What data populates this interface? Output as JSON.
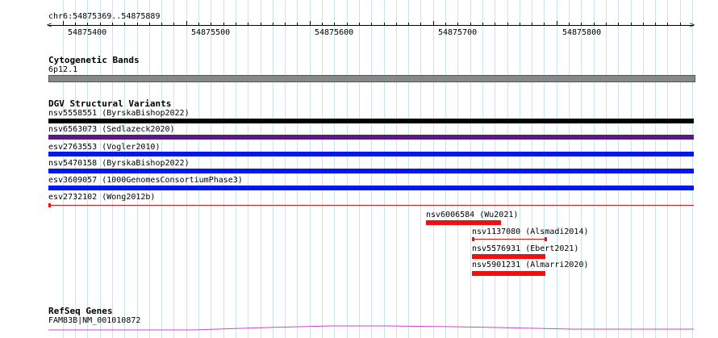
{
  "locus": "chr6:54875369..54875889",
  "ruler_ticks": [
    "54875400",
    "54875500",
    "54875600",
    "54875700",
    "54875800"
  ],
  "tracks": {
    "cytoband": {
      "title": "Cytogenetic Bands",
      "band_label": "6p12.1",
      "band_color": "#888888"
    },
    "dgv": {
      "title": "DGV Structural Variants",
      "full_width_variants": [
        {
          "label": "nsv5558551 (ByrskaBishop2022)",
          "color": "#000000"
        },
        {
          "label": "nsv6563073 (Sedlazeck2020)",
          "color": "#5a1a82"
        },
        {
          "label": "esv2763553 (Vogler2010)",
          "color": "#0018ee"
        },
        {
          "label": "nsv5470158 (ByrskaBishop2022)",
          "color": "#0018ee"
        },
        {
          "label": "esv3609057 (1000GenomesConsortiumPhase3)",
          "color": "#0018ee"
        },
        {
          "label": "esv2732102 (Wong2012b)",
          "color": "#ee1111"
        }
      ],
      "local_variants": [
        {
          "label": "nsv6006584 (Wu2021)",
          "color": "#ee1111"
        },
        {
          "label": "nsv1137080 (Alsmadi2014)",
          "color": "#ee1111"
        },
        {
          "label": "nsv5576931 (Ebert2021)",
          "color": "#ee1111"
        },
        {
          "label": "nsv5901231 (Almarri2020)",
          "color": "#ee1111"
        }
      ]
    },
    "refseq": {
      "title": "RefSeq Genes",
      "gene_label": "FAM83B|NM_001010872",
      "line_color": "#cc44cc"
    }
  }
}
